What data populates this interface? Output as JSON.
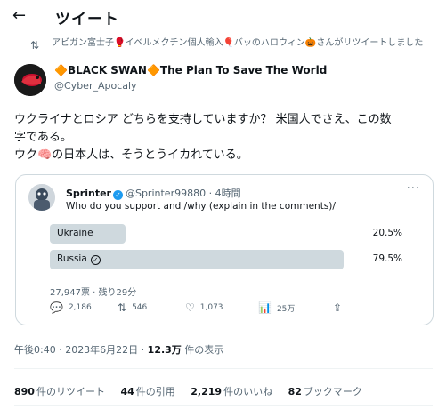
{
  "header": {
    "back_icon": "arrow-left-icon",
    "title": "ツイート"
  },
  "retweet": {
    "icon": "retweet-icon",
    "text": "アビガン富士子🥊イベルメクチン個人輸入🎈バッのハロウィン🎃さんがリツイートしました"
  },
  "author": {
    "name": "🔶BLACK SWAN🔶The Plan To Save The World",
    "handle": "@Cyber_Apocaly"
  },
  "tweet": {
    "line1": "ウクライナとロシア どちらを支持していますか？ 米国人でさえ、この数",
    "line2": "字である。",
    "line3": "ウク🧠の日本人は、そうとうイカれている。"
  },
  "quote": {
    "name": "Sprinter",
    "verified_icon": "verified-badge-icon",
    "meta": "@Sprinter99880 · 4時間",
    "more": "···",
    "text": "Who do you support and /why (explain in the comments)/",
    "poll": {
      "options": [
        {
          "label": "Ukraine",
          "percent": "20.5%",
          "value": 20.5
        },
        {
          "label": "Russia",
          "percent": "79.5%",
          "value": 79.5,
          "selected": true
        }
      ],
      "footer": "27,947票 · 残り29分"
    },
    "actions": {
      "reply": "2,186",
      "retweet": "546",
      "like": "1,073",
      "views": "25万",
      "share": ""
    }
  },
  "timestamp": {
    "time": "午後0:40 · 2023年6月22日 · ",
    "views": "12.3万",
    "views_label": " 件の表示"
  },
  "stats": {
    "retweets": "890",
    "retweets_label": "件のリツイート",
    "quotes": "44",
    "quotes_label": "件の引用",
    "likes": "2,219",
    "likes_label": "件のいいね",
    "bookmarks": "82",
    "bookmarks_label": "ブックマーク"
  },
  "colors": {
    "accent": "#1d9bf0",
    "secondary_text": "#536471",
    "poll_bar": "#cfd9de"
  }
}
